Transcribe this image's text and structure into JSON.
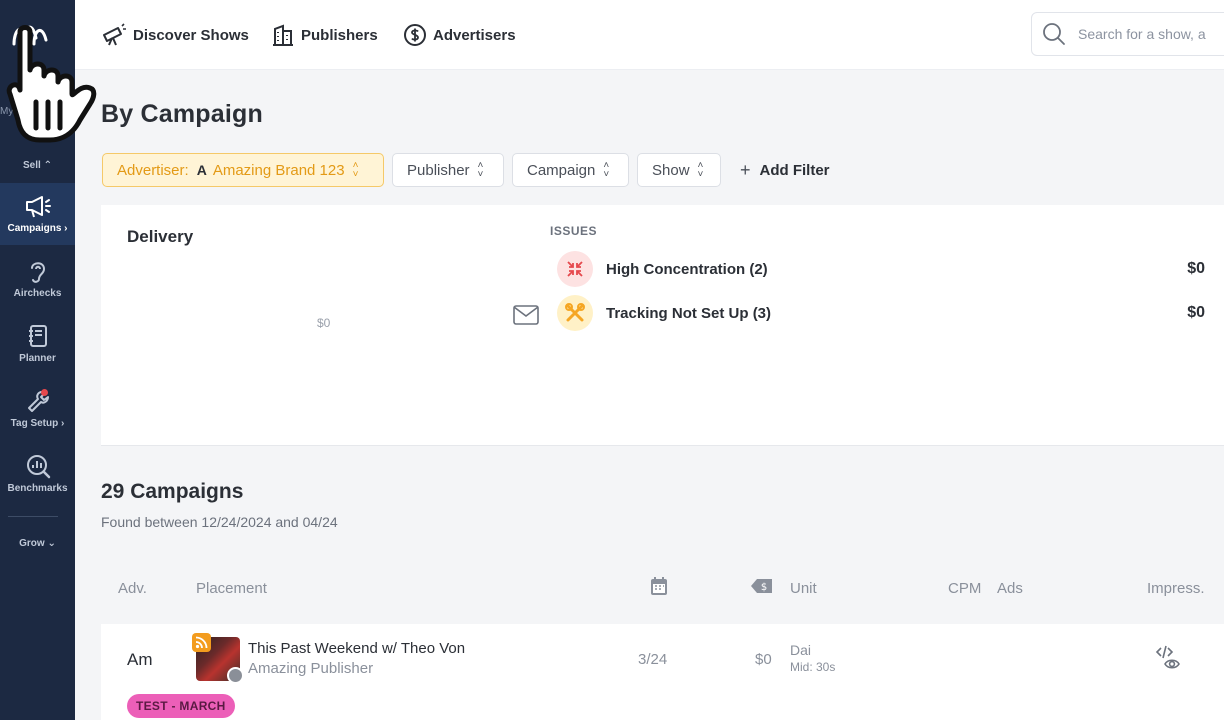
{
  "nav": {
    "discover": "Discover Shows",
    "publishers": "Publishers",
    "advertisers": "Advertisers",
    "search_placeholder": "Search for a show, a"
  },
  "sidebar": {
    "my_label": "My",
    "sell_label": "Sell",
    "grow_label": "Grow",
    "items": [
      {
        "label": "Campaigns",
        "icon": "megaphone-icon",
        "active": true
      },
      {
        "label": "Airchecks",
        "icon": "ear-icon"
      },
      {
        "label": "Planner",
        "icon": "notebook-icon"
      },
      {
        "label": "Tag Setup",
        "icon": "wrench-icon"
      },
      {
        "label": "Benchmarks",
        "icon": "chart-magnifier-icon"
      }
    ]
  },
  "page": {
    "title": "By Campaign"
  },
  "filters": {
    "advertiser_label": "Advertiser:",
    "advertiser_initial": "A",
    "advertiser_value": "Amazing Brand 123",
    "publisher": "Publisher",
    "campaign": "Campaign",
    "show": "Show",
    "add_filter": "Add Filter"
  },
  "delivery": {
    "title": "Delivery",
    "value": "$0",
    "issues_label": "ISSUES",
    "issues": [
      {
        "label": "High Concentration (2)",
        "value": "$0",
        "icon": "compress-icon",
        "color": "#e5484d"
      },
      {
        "label": "Tracking Not Set Up (3)",
        "value": "$0",
        "icon": "tools-icon",
        "color": "#f5a623"
      }
    ]
  },
  "campaigns": {
    "title": "29 Campaigns",
    "subtitle": "Found between 12/24/2024 and 04/24",
    "columns": {
      "adv": "Adv.",
      "placement": "Placement",
      "unit": "Unit",
      "cpm": "CPM",
      "ads": "Ads",
      "impress": "Impress."
    },
    "rows": [
      {
        "adv": "Am",
        "show": "This Past Weekend w/ Theo Von",
        "publisher": "Amazing Publisher",
        "date": "3/24",
        "price": "$0",
        "unit": "Dai",
        "unit_detail": "Mid: 30s",
        "tag": "TEST - MARCH"
      }
    ]
  }
}
